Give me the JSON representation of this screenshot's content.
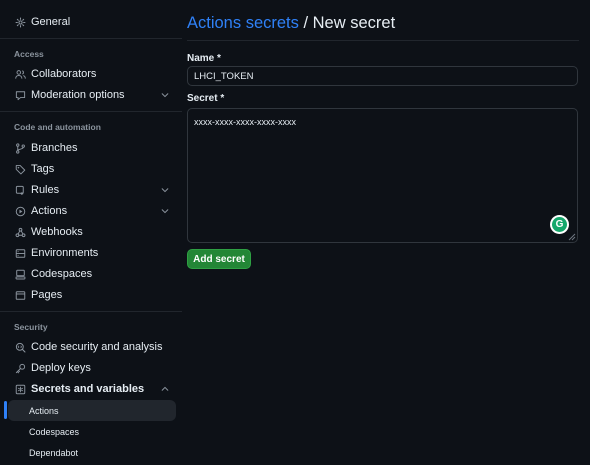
{
  "sidebar": {
    "top_item": {
      "label": "General",
      "icon": "gear-icon"
    },
    "sections": {
      "access": "Access",
      "code": "Code and automation",
      "security": "Security"
    },
    "items": {
      "collaborators": {
        "label": "Collaborators",
        "icon": "people-icon"
      },
      "moderation": {
        "label": "Moderation options",
        "icon": "comment-icon"
      },
      "branches": {
        "label": "Branches",
        "icon": "branch-icon"
      },
      "tags": {
        "label": "Tags",
        "icon": "tag-icon"
      },
      "rules": {
        "label": "Rules",
        "icon": "rules-icon"
      },
      "actions": {
        "label": "Actions",
        "icon": "play-icon"
      },
      "webhooks": {
        "label": "Webhooks",
        "icon": "webhook-icon"
      },
      "environments": {
        "label": "Environments",
        "icon": "server-icon"
      },
      "codespaces": {
        "label": "Codespaces",
        "icon": "codespaces-icon"
      },
      "pages": {
        "label": "Pages",
        "icon": "browser-icon"
      },
      "code_security": {
        "label": "Code security and analysis",
        "icon": "codescan-icon"
      },
      "deploy_keys": {
        "label": "Deploy keys",
        "icon": "key-icon"
      },
      "secrets": {
        "label": "Secrets and variables",
        "icon": "asterisk-icon"
      }
    },
    "sub_items": {
      "actions": "Actions",
      "codespaces": "Codespaces",
      "dependabot": "Dependabot"
    }
  },
  "main": {
    "breadcrumb_link": "Actions secrets",
    "separator": " / ",
    "title": "New secret",
    "name_label": "Name *",
    "name_value": "LHCI_TOKEN",
    "secret_label": "Secret *",
    "secret_value": "xxxx-xxxx-xxxx-xxxx-xxxx",
    "submit_label": "Add secret",
    "grammarly_glyph": "G"
  },
  "colors": {
    "background": "#0d1117",
    "link": "#2f81f7",
    "button": "#238636",
    "border": "#30363d",
    "muted": "#8b949e"
  }
}
